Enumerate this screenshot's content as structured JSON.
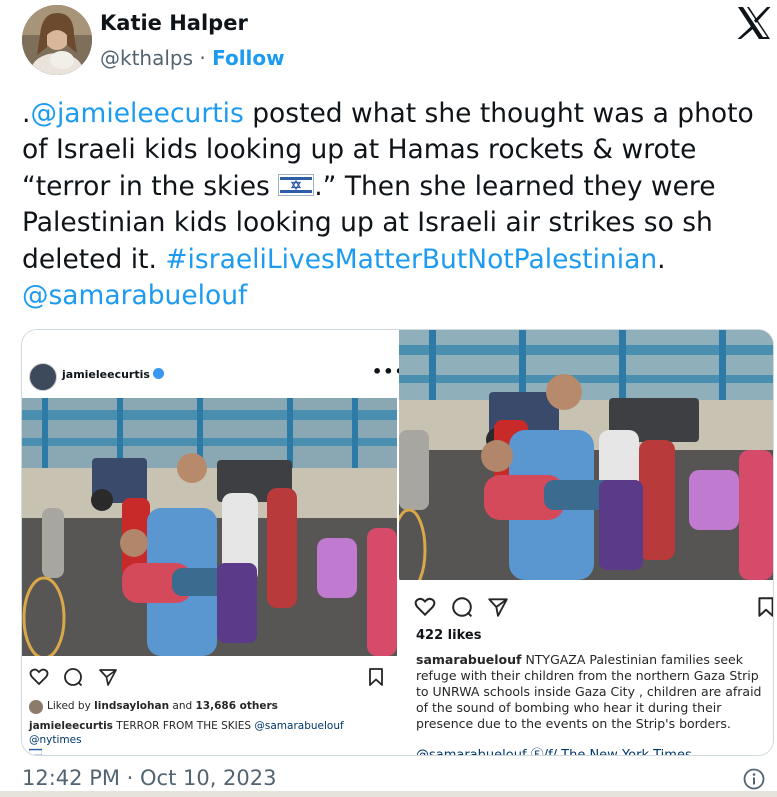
{
  "author": {
    "name": "Katie Halper",
    "handle": "@kthalps",
    "separator": "·",
    "follow_label": "Follow"
  },
  "icons": {
    "x_logo": "x-logo-icon",
    "info": "info-icon",
    "verified": "verified-badge-icon",
    "heart": "heart-icon",
    "comment": "comment-icon",
    "share": "share-icon",
    "bookmark": "bookmark-icon",
    "more": "more-options-icon"
  },
  "tweet": {
    "p1": ".",
    "mention1": "@jamieleecurtis",
    "p2": " posted what she thought was a photo of Israeli kids looking up at Hamas rockets & wrote “terror in the skies ",
    "p3": ".” Then she learned they were Palestinian kids looking up at Israeli air strikes so sh deleted it. ",
    "hashtag": "#israeliLivesMatterButNotPalestinian",
    "p4": ".",
    "mention2": "@samarabuelouf"
  },
  "left_post": {
    "username": "jamieleecurtis",
    "more": "•••",
    "liked_by_prefix": "Liked by ",
    "liked_by_user": "lindsaylohan",
    "liked_by_mid": " and ",
    "liked_by_count": "13,686 others",
    "caption_user": "jamieleecurtis",
    "caption_text": " TERROR FROM THE SKIES ",
    "caption_tag1": "@samarabuelouf",
    "caption_tag2": " @nytimes"
  },
  "right_post": {
    "likes": "422 likes",
    "caption_user": "samarabuelouf",
    "caption_text": " NTYGAZA Palestinian families seek refuge with their children from the northern Gaza Strip to UNRWA schools inside Gaza City , children are afraid of the sound of bombing who hear it during their presence due to the events on the Strip's borders.",
    "cut_line": "@samarabuelouf Ⓕ/f/ The New York Times"
  },
  "timestamp": "12:42 PM · Oct 10, 2023",
  "colors": {
    "link": "#1d9bf0",
    "text": "#0f1419",
    "secondary": "#536471",
    "border": "#cfd9de"
  }
}
